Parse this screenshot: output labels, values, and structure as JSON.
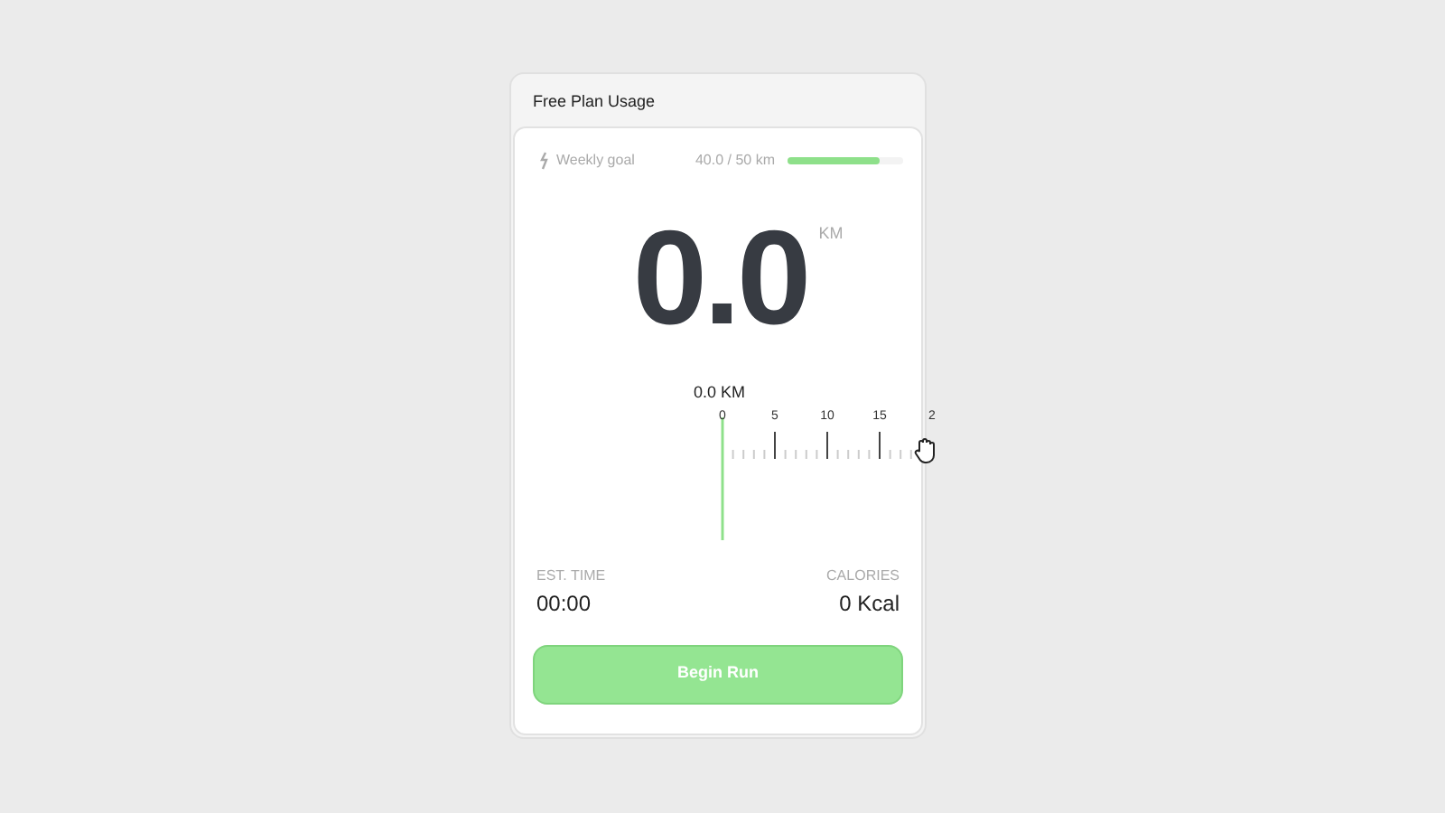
{
  "panel": {
    "title": "Free Plan Usage"
  },
  "weekly_goal": {
    "label": "Weekly goal",
    "reading": "40.0 / 50 km",
    "level": 0.8
  },
  "distance": {
    "value": "0.0",
    "unit": "KM"
  },
  "ruler": {
    "reading": "0.0 KM",
    "tick_labels": [
      "0",
      "5",
      "10",
      "15",
      "2"
    ]
  },
  "stats": [
    {
      "label": "EST. TIME",
      "value": "00:00"
    },
    {
      "label": "CALORIES",
      "value": "0 Kcal"
    }
  ],
  "button": {
    "label": "Begin Run"
  }
}
